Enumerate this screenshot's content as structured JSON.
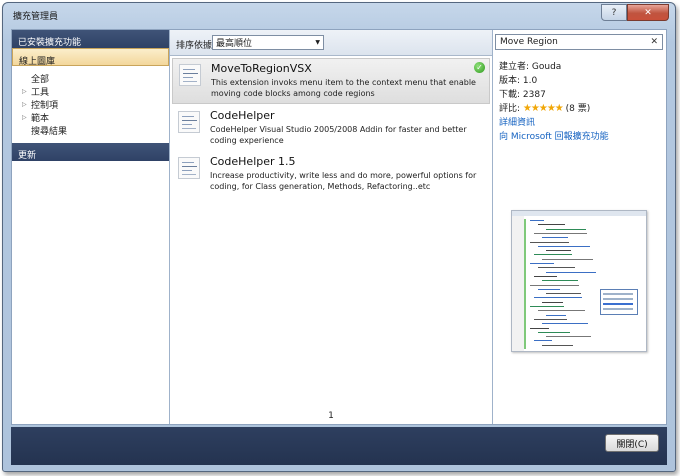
{
  "window": {
    "title": "擴充管理員",
    "help_glyph": "?",
    "close_glyph": "✕"
  },
  "sidebar": {
    "installed": "已安裝擴充功能",
    "online": "線上圖庫",
    "items": [
      {
        "label": "全部",
        "expandable": false
      },
      {
        "label": "工具",
        "expandable": true
      },
      {
        "label": "控制項",
        "expandable": true
      },
      {
        "label": "範本",
        "expandable": true
      },
      {
        "label": "搜尋結果",
        "expandable": false
      }
    ],
    "updates": "更新"
  },
  "sortbar": {
    "label": "排序依據:",
    "value": "最高順位"
  },
  "extensions": [
    {
      "name": "MoveToRegionVSX",
      "description": "This extension  invoks menu item to the context menu that enable moving code blocks among code regions",
      "installed": true
    },
    {
      "name": "CodeHelper",
      "description": "CodeHelper  Visual Studio 2005/2008 Addin for faster and better coding experience",
      "installed": false
    },
    {
      "name": "CodeHelper 1.5",
      "description": "Increase productivity, write less and do more, powerful options for coding, for Class generation, Methods, Refactoring..etc",
      "installed": false
    }
  ],
  "pager": {
    "page": "1"
  },
  "search": {
    "value": "Move Region",
    "clear_glyph": "✕"
  },
  "details": {
    "author": "建立者: Gouda",
    "version": "版本: 1.0",
    "downloads": "下載: 2387",
    "rating_label": "評比:",
    "rating_stars": 5,
    "rating_votes": "(8 票)",
    "more_info": "詳細資訊",
    "report": "向 Microsoft 回報擴充功能"
  },
  "footer": {
    "close_label": "關閉(C)"
  }
}
